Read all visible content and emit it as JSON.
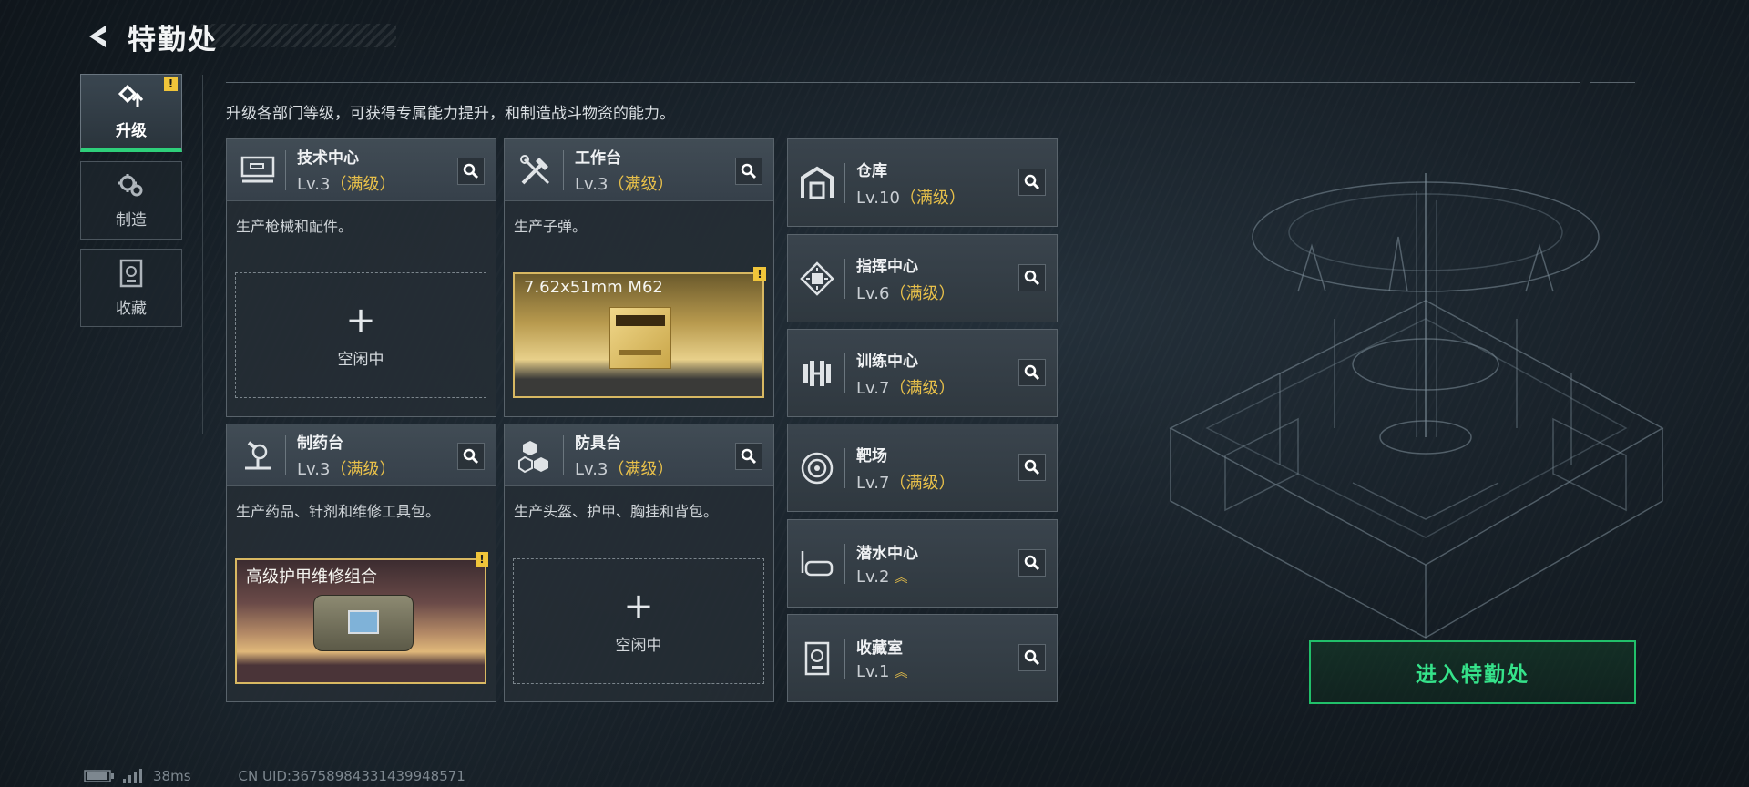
{
  "header": {
    "title": "特勤处"
  },
  "nav": [
    {
      "label": "升级",
      "icon": "upgrade-icon",
      "active": true,
      "alert": "!"
    },
    {
      "label": "制造",
      "icon": "craft-gear-icon"
    },
    {
      "label": "收藏",
      "icon": "collection-icon"
    }
  ],
  "subtitle": "升级各部门等级，可获得专属能力提升，和制造战斗物资的能力。",
  "cards": [
    {
      "name": "技术中心",
      "level": "Lv.3",
      "max": "（满级）",
      "desc": "生产枪械和配件。",
      "slot_plus": "+",
      "slot_status": "空闲中"
    },
    {
      "name": "工作台",
      "level": "Lv.3",
      "max": "（满级）",
      "desc": "生产子弹。",
      "product": "7.62x51mm M62",
      "alert": "!"
    },
    {
      "name": "制药台",
      "level": "Lv.3",
      "max": "（满级）",
      "desc": "生产药品、针剂和维修工具包。",
      "product": "高级护甲维修组合",
      "alert": "!"
    },
    {
      "name": "防具台",
      "level": "Lv.3",
      "max": "（满级）",
      "desc": "生产头盔、护甲、胸挂和背包。",
      "slot_plus": "+",
      "slot_status": "空闲中"
    }
  ],
  "facilities": [
    {
      "name": "仓库",
      "level": "Lv.10",
      "max": "（满级）",
      "icon": "warehouse-icon"
    },
    {
      "name": "指挥中心",
      "level": "Lv.6",
      "max": "（满级）",
      "icon": "command-chip-icon"
    },
    {
      "name": "训练中心",
      "level": "Lv.7",
      "max": "（满级）",
      "icon": "dumbbell-icon"
    },
    {
      "name": "靶场",
      "level": "Lv.7",
      "max": "（满级）",
      "icon": "target-icon"
    },
    {
      "name": "潜水中心",
      "level": "Lv.2",
      "max": "",
      "icon": "diving-mask-icon",
      "upgrade": "︽"
    },
    {
      "name": "收藏室",
      "level": "Lv.1",
      "max": "",
      "icon": "collection-room-icon",
      "upgrade": "︽"
    }
  ],
  "enter_button": "进入特勤处",
  "footer": {
    "ping": "38ms",
    "uid": "CN UID:3675898433143994857​1"
  },
  "colors": {
    "accent_green": "#2ecf7a",
    "max_level": "#e8c04a",
    "alert": "#f0c53a"
  }
}
